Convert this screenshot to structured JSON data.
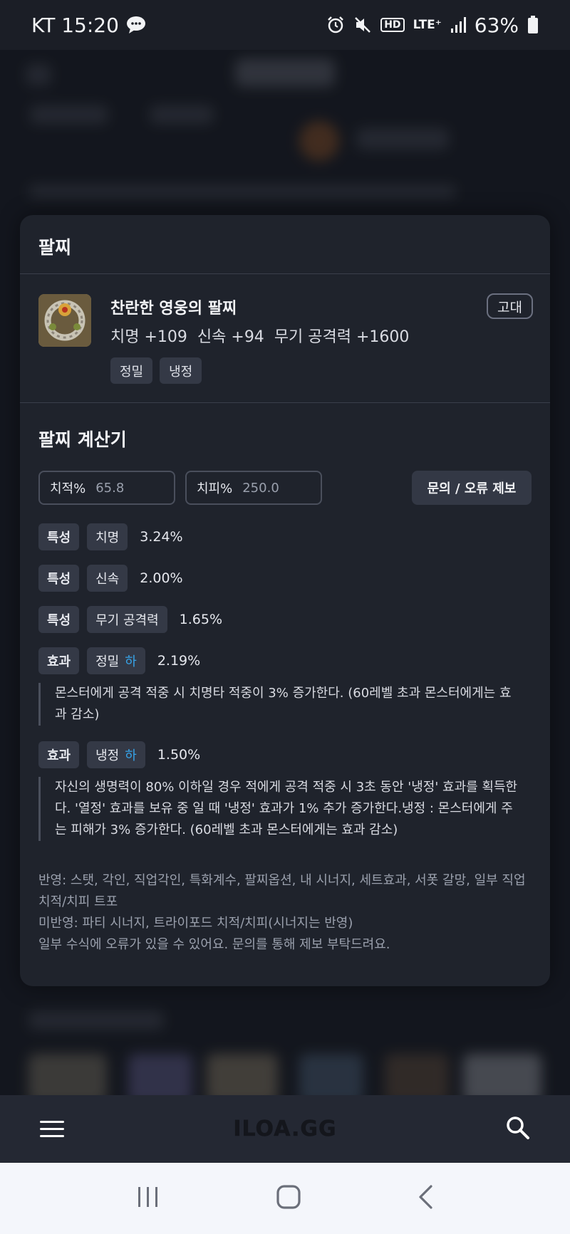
{
  "status_bar": {
    "carrier_time": "KT 15:20",
    "battery": "63%",
    "hd": "HD",
    "lte": "LTE⁺"
  },
  "sheet": {
    "title": "팔찌",
    "item": {
      "name": "찬란한 영웅의 팔찌",
      "grade": "고대",
      "stats": [
        "치명 +109",
        "신속 +94",
        "무기 공격력 +1600"
      ],
      "tags": [
        "정밀",
        "냉정"
      ]
    }
  },
  "calculator": {
    "title": "팔찌 계산기",
    "crit_rate": {
      "label": "치적%",
      "value": "65.8"
    },
    "crit_damage": {
      "label": "치피%",
      "value": "250.0"
    },
    "report_button": "문의 / 오류 제보",
    "rows": [
      {
        "kind": "특성",
        "name": "치명",
        "tier": "",
        "value": "3.24%"
      },
      {
        "kind": "특성",
        "name": "신속",
        "tier": "",
        "value": "2.00%"
      },
      {
        "kind": "특성",
        "name": "무기 공격력",
        "tier": "",
        "value": "1.65%"
      },
      {
        "kind": "효과",
        "name": "정밀",
        "tier": "하",
        "value": "2.19%"
      },
      {
        "kind": "효과",
        "name": "냉정",
        "tier": "하",
        "value": "1.50%"
      }
    ],
    "effect_descriptions": {
      "precision": "몬스터에게 공격 적중 시 치명타 적중이 3% 증가한다. (60레벨 초과 몬스터에게는 효과 감소)",
      "calm": "자신의 생명력이 80% 이하일 경우 적에게 공격 적중 시 3초 동안 '냉정' 효과를 획득한다. '열정' 효과를 보유 중 일 때 '냉정' 효과가 1% 추가 증가한다.냉정 : 몬스터에게 주는 피해가 3% 증가한다. (60레벨 초과 몬스터에게는 효과 감소)"
    },
    "notes": [
      "반영: 스탯, 각인, 직업각인, 특화계수, 팔찌옵션, 내 시너지, 세트효과, 서폿 갈망, 일부 직업 치적/치피 트포",
      "미반영: 파티 시너지, 트라이포드 치적/치피(시너지는 반영)",
      "일부 수식에 오류가 있을 수 있어요. 문의를 통해 제보 부탁드려요."
    ]
  },
  "app_bar": {
    "brand": "ILOA.GG"
  },
  "colors": {
    "accent_tier": "#36a3e8",
    "sheet_bg": "#1f232c",
    "chip_bg": "#343946"
  },
  "icons": [
    "chat-bubble-icon",
    "alarm-icon",
    "mute-icon",
    "signal-icon",
    "battery-icon",
    "menu-icon",
    "search-icon",
    "recent-apps-icon",
    "home-icon",
    "back-icon"
  ]
}
